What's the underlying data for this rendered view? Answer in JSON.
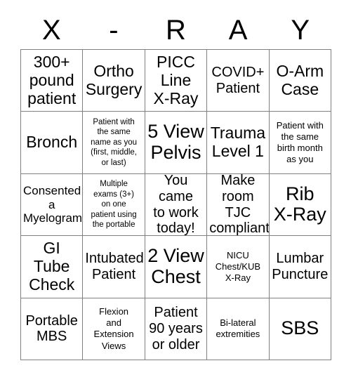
{
  "card": {
    "title_letters": [
      "X",
      "-",
      "R",
      "A",
      "Y"
    ],
    "border_color": "#808080",
    "text_color": "#000000",
    "background_color": "#ffffff",
    "columns": 5,
    "rows": 5
  },
  "grid": {
    "cells": [
      {
        "text": "300+\npound\npatient",
        "size": "xl"
      },
      {
        "text": "Ortho\nSurgery",
        "size": "xl"
      },
      {
        "text": "PICC\nLine\nX-Ray",
        "size": "xl"
      },
      {
        "text": "COVID+\nPatient",
        "size": "l"
      },
      {
        "text": "O-Arm\nCase",
        "size": "xl"
      },
      {
        "text": "Bronch",
        "size": "xl"
      },
      {
        "text": "Patient with\nthe same\nname as you\n(first, middle,\nor last)",
        "size": "xs"
      },
      {
        "text": "5 View\nPelvis",
        "size": "xxl"
      },
      {
        "text": "Trauma\nLevel 1",
        "size": "xl"
      },
      {
        "text": "Patient with\nthe same\nbirth month\nas you",
        "size": "s"
      },
      {
        "text": "Consented\na\nMyelogram",
        "size": "m"
      },
      {
        "text": "Multiple\nexams (3+)\non one\npatient using\nthe portable",
        "size": "xs"
      },
      {
        "text": "You came\nto work\ntoday!",
        "size": "l"
      },
      {
        "text": "Make\nroom TJC\ncompliant",
        "size": "l"
      },
      {
        "text": "Rib\nX-Ray",
        "size": "xxl"
      },
      {
        "text": "GI\nTube\nCheck",
        "size": "xl"
      },
      {
        "text": "Intubated\nPatient",
        "size": "l"
      },
      {
        "text": "2 View\nChest",
        "size": "xxl"
      },
      {
        "text": "NICU\nChest/KUB\nX-Ray",
        "size": "s"
      },
      {
        "text": "Lumbar\nPuncture",
        "size": "l"
      },
      {
        "text": "Portable\nMBS",
        "size": "l"
      },
      {
        "text": "Flexion\nand\nExtension\nViews",
        "size": "s"
      },
      {
        "text": "Patient\n90 years\nor older",
        "size": "l"
      },
      {
        "text": "Bi-lateral\nextremities",
        "size": "s"
      },
      {
        "text": "SBS",
        "size": "xxl"
      }
    ]
  }
}
